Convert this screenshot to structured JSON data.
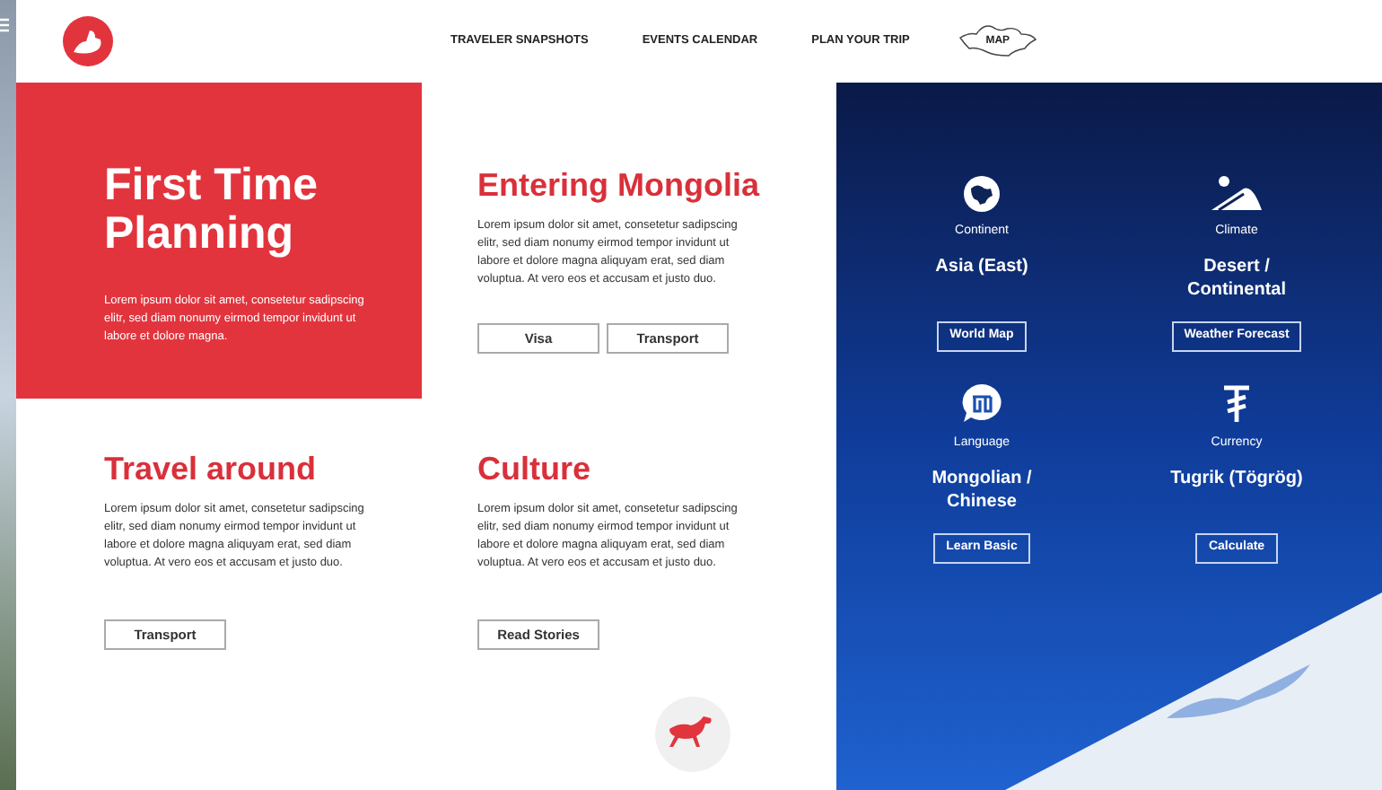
{
  "nav": {
    "links": [
      {
        "label": "TRAVELER SNAPSHOTS",
        "kind": "text"
      },
      {
        "label": "EVENTS CALENDAR",
        "kind": "text"
      },
      {
        "label": "PLAN YOUR TRIP",
        "kind": "text"
      },
      {
        "label": "MAP",
        "kind": "map"
      }
    ]
  },
  "sections": [
    {
      "kind": "feature",
      "title": "First Time Planning",
      "body": "Lorem ipsum dolor sit amet, consetetur sadipscing elitr,  sed diam nonumy eirmod tempor invidunt ut labore et dolore magna."
    },
    {
      "kind": "plain",
      "title": "Entering Mongolia",
      "body": "Lorem ipsum dolor sit amet, consetetur sadipscing elitr,  sed diam nonumy eirmod tempor invidunt ut labore et dolore magna aliquyam erat, sed diam voluptua. At vero eos et accusam et justo duo.",
      "buttons": [
        "Visa",
        "Transport"
      ]
    },
    {
      "kind": "plain",
      "title": "Travel around",
      "body": "Lorem ipsum dolor sit amet, consetetur sadipscing elitr,  sed diam nonumy eirmod tempor invidunt ut labore et dolore magna aliquyam erat, sed diam voluptua. At vero eos et accusam et justo duo.",
      "buttons": [
        "Transport"
      ]
    },
    {
      "kind": "plain",
      "title": "Culture",
      "body": "Lorem ipsum dolor sit amet, consetetur sadipscing elitr,  sed diam nonumy eirmod tempor invidunt ut labore et dolore magna aliquyam erat, sed diam voluptua. At vero eos et accusam et justo duo.",
      "buttons": [
        "Read Stories"
      ]
    }
  ],
  "facts": [
    {
      "kind": "globe",
      "label": "Continent",
      "value": "Asia (East)",
      "button": "World Map"
    },
    {
      "kind": "desert",
      "label": "Climate",
      "value": "Desert / Continental",
      "button": "Weather Forecast"
    },
    {
      "kind": "speech",
      "label": "Language",
      "value": "Mongolian / Chinese",
      "button": "Learn Basic"
    },
    {
      "kind": "currency",
      "label": "Currency",
      "value": "Tugrik (Tögrög)",
      "button": "Calculate"
    }
  ]
}
